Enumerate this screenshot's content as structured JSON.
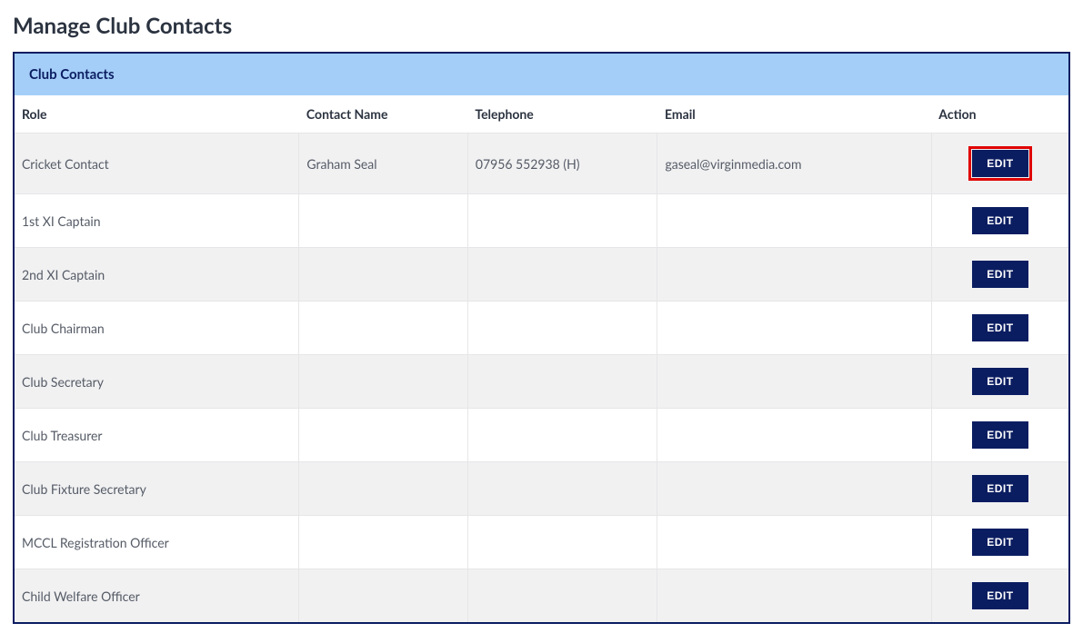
{
  "page": {
    "title": "Manage Club Contacts"
  },
  "panel": {
    "title": "Club Contacts"
  },
  "table": {
    "headers": {
      "role": "Role",
      "name": "Contact Name",
      "tel": "Telephone",
      "email": "Email",
      "action": "Action"
    },
    "edit_label": "EDIT",
    "rows": [
      {
        "role": "Cricket Contact",
        "name": "Graham Seal",
        "tel": "07956 552938 (H)",
        "email": "gaseal@virginmedia.com",
        "highlight": true
      },
      {
        "role": "1st XI Captain",
        "name": "",
        "tel": "",
        "email": "",
        "highlight": false
      },
      {
        "role": "2nd XI Captain",
        "name": "",
        "tel": "",
        "email": "",
        "highlight": false
      },
      {
        "role": "Club Chairman",
        "name": "",
        "tel": "",
        "email": "",
        "highlight": false
      },
      {
        "role": "Club Secretary",
        "name": "",
        "tel": "",
        "email": "",
        "highlight": false
      },
      {
        "role": "Club Treasurer",
        "name": "",
        "tel": "",
        "email": "",
        "highlight": false
      },
      {
        "role": "Club Fixture Secretary",
        "name": "",
        "tel": "",
        "email": "",
        "highlight": false
      },
      {
        "role": "MCCL Registration Officer",
        "name": "",
        "tel": "",
        "email": "",
        "highlight": false
      },
      {
        "role": "Child Welfare Officer",
        "name": "",
        "tel": "",
        "email": "",
        "highlight": false
      }
    ]
  }
}
